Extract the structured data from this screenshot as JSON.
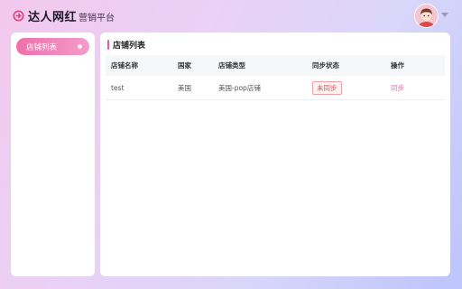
{
  "header": {
    "brand": "达人网红",
    "brand_sub": "营销平台"
  },
  "sidebar": {
    "items": [
      {
        "label": "店铺列表",
        "active": true
      }
    ]
  },
  "main": {
    "title": "店铺列表",
    "table": {
      "columns": [
        "店铺名称",
        "国家",
        "店铺类型",
        "同步状态",
        "操作"
      ],
      "rows": [
        {
          "name": "test",
          "country": "美国",
          "type": "美国-pop店铺",
          "status": "未同步",
          "action": "同步"
        }
      ]
    }
  },
  "colors": {
    "accent": "#ee6fa9",
    "status_unsynced": "#e04a55",
    "title_bar": "#e85a9a"
  },
  "icons": {
    "logo": "circle-logo-icon",
    "avatar": "user-avatar",
    "caret": "chevron-down-icon"
  }
}
